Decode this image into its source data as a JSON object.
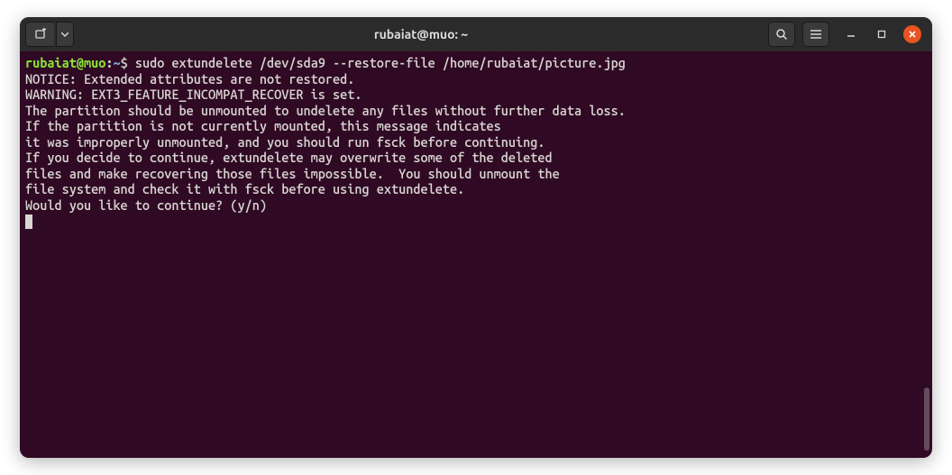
{
  "window": {
    "title": "rubaiat@muo: ~"
  },
  "prompt": {
    "user_host": "rubaiat@muo",
    "colon": ":",
    "path": "~",
    "dollar": "$"
  },
  "command": "sudo extundelete /dev/sda9 --restore-file /home/rubaiat/picture.jpg",
  "output": {
    "l1": "NOTICE: Extended attributes are not restored.",
    "l2": "WARNING: EXT3_FEATURE_INCOMPAT_RECOVER is set.",
    "l3": "The partition should be unmounted to undelete any files without further data loss.",
    "l4": "If the partition is not currently mounted, this message indicates",
    "l5": "it was improperly unmounted, and you should run fsck before continuing.",
    "l6": "If you decide to continue, extundelete may overwrite some of the deleted",
    "l7": "files and make recovering those files impossible.  You should unmount the",
    "l8": "file system and check it with fsck before using extundelete.",
    "l9": "Would you like to continue? (y/n)"
  }
}
